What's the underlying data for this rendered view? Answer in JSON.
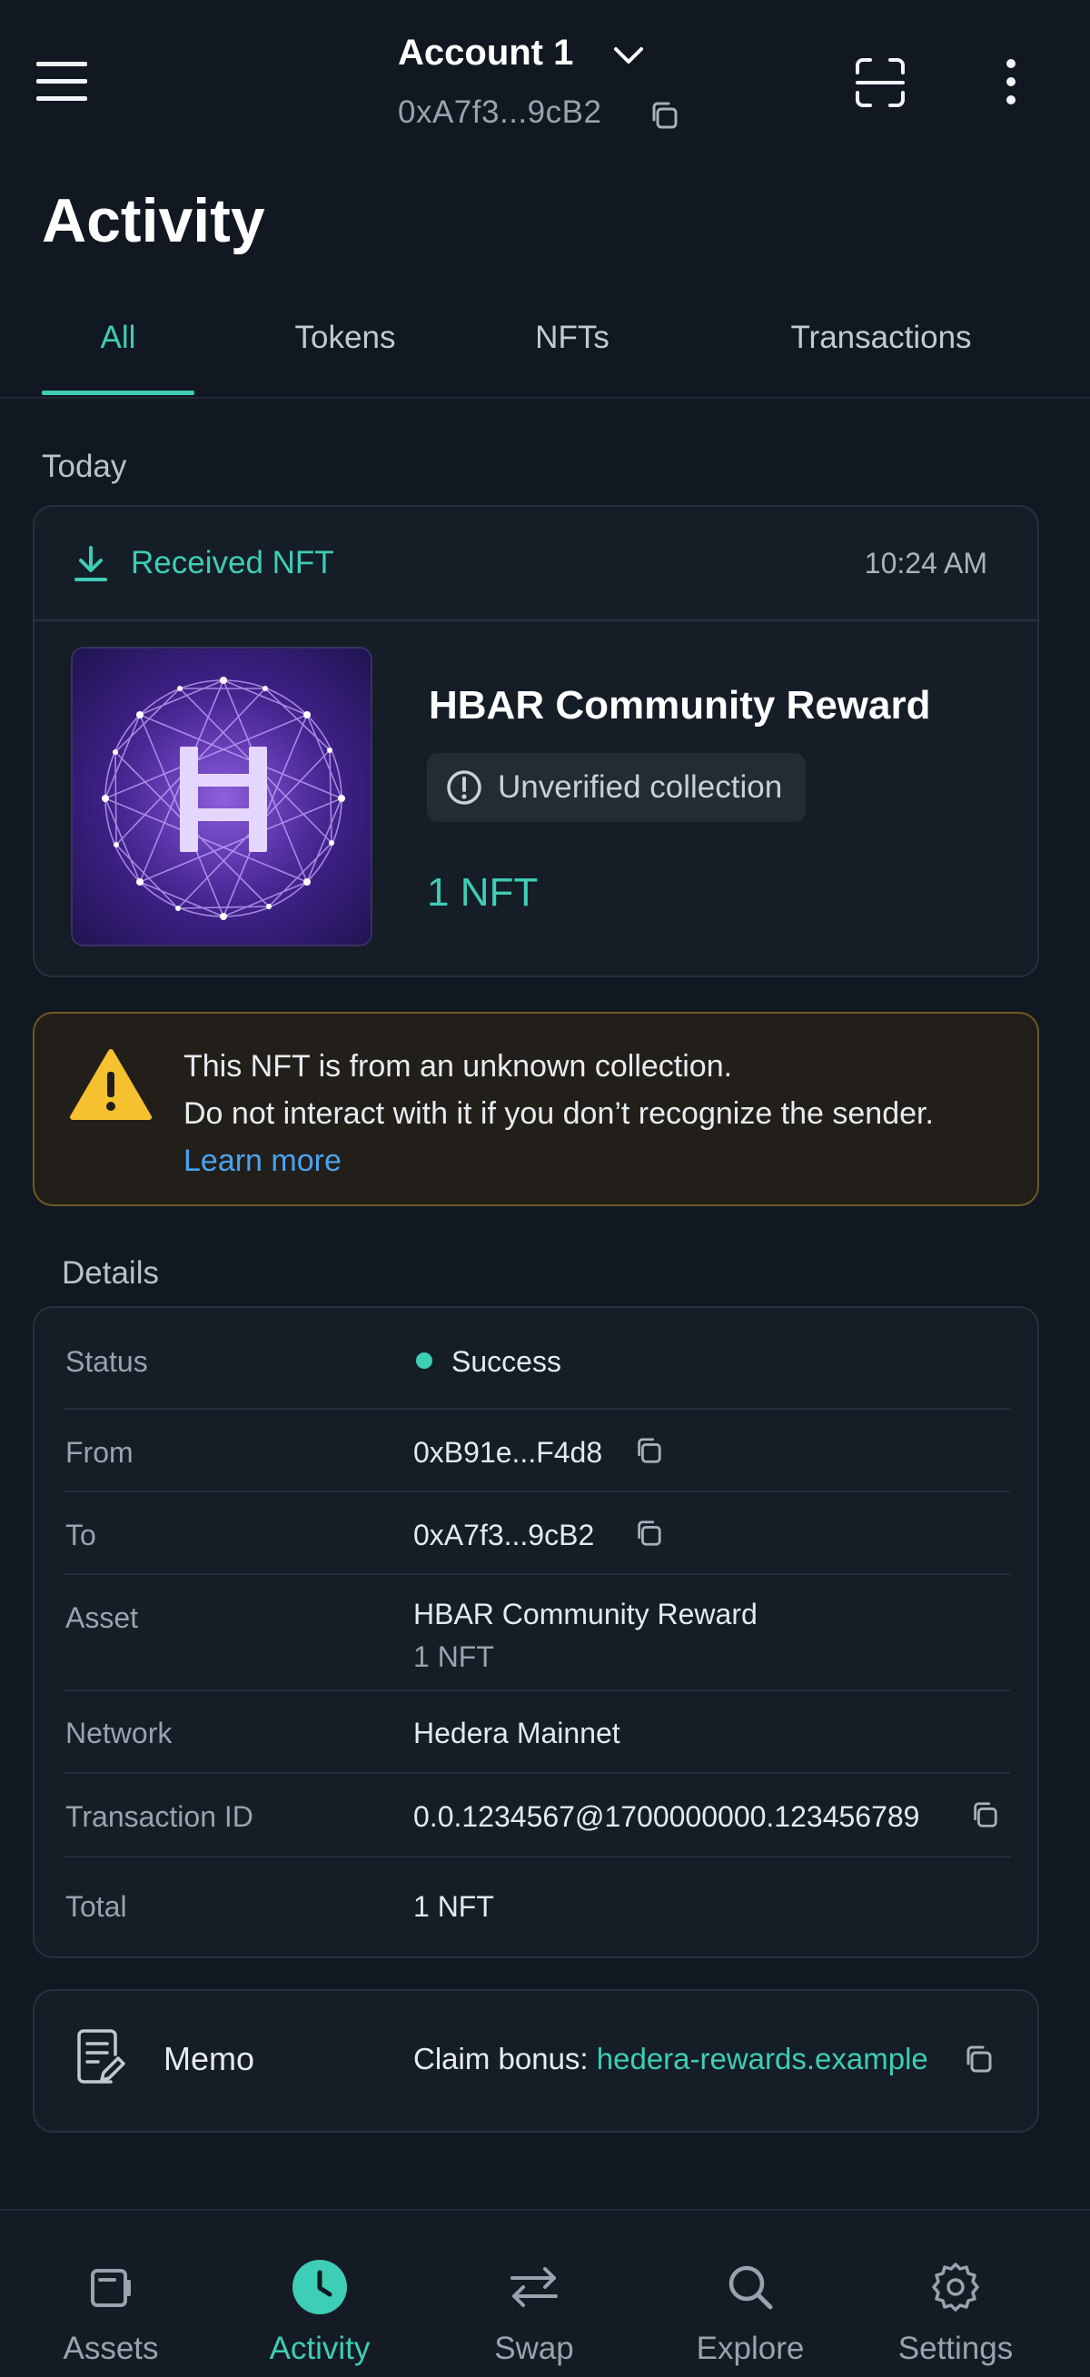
{
  "header": {
    "account_name": "Account 1",
    "account_address": "0xA7f3...9cB2",
    "icons": [
      "menu-icon",
      "chevron-down-icon",
      "copy-icon",
      "scan-icon",
      "more-vertical-icon"
    ]
  },
  "page": {
    "title": "Activity"
  },
  "tabs": [
    {
      "label": "All",
      "active": true
    },
    {
      "label": "Tokens",
      "active": false
    },
    {
      "label": "NFTs",
      "active": false
    },
    {
      "label": "Transactions",
      "active": false
    }
  ],
  "activity": {
    "date_group": "Today",
    "type_label": "Received NFT",
    "time": "10:24 AM",
    "nft_name": "HBAR Community Reward",
    "nft_badge": "Unverified collection",
    "nft_amount": "1 NFT"
  },
  "warning": {
    "line1": "This NFT is from an unknown collection.",
    "line2": "Do not interact with it if you don’t recognize the sender.",
    "link": "Learn more"
  },
  "details": {
    "heading": "Details",
    "rows": [
      {
        "label": "Status",
        "value": "Success"
      },
      {
        "label": "From",
        "value": "0xB91e...F4d8"
      },
      {
        "label": "To",
        "value": "0xA7f3...9cB2"
      },
      {
        "label": "Asset",
        "value": "HBAR Community Reward",
        "sub": "1 NFT"
      },
      {
        "label": "Network",
        "value": "Hedera Mainnet"
      },
      {
        "label": "Transaction ID",
        "value": "0.0.1234567@1700000000.123456789"
      },
      {
        "label": "Total",
        "value": "1 NFT"
      }
    ]
  },
  "memo": {
    "label": "Memo",
    "prefix": "Claim bonus: ",
    "link": "hedera-rewards.example"
  },
  "nav": [
    {
      "label": "Assets",
      "icon": "wallet-icon",
      "active": false
    },
    {
      "label": "Activity",
      "icon": "clock-icon",
      "active": true
    },
    {
      "label": "Swap",
      "icon": "swap-icon",
      "active": false
    },
    {
      "label": "Explore",
      "icon": "search-icon",
      "active": false
    },
    {
      "label": "Settings",
      "icon": "gear-icon",
      "active": false
    }
  ],
  "colors": {
    "background": "#111821",
    "accent": "#3ecdb5",
    "warning": "#f5c12e",
    "link": "#4aa3f0"
  }
}
